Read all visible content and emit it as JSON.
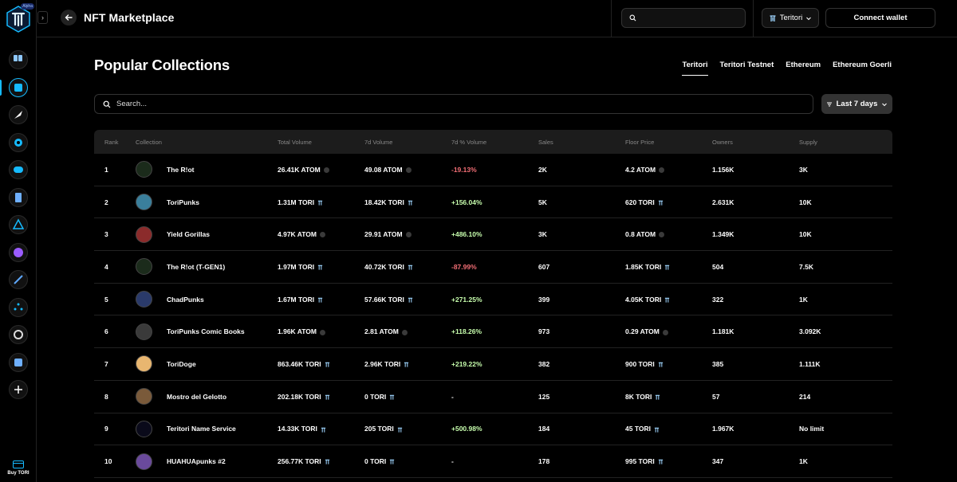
{
  "app": {
    "alpha_badge": "Alpha",
    "title": "NFT Marketplace",
    "search_placeholder": "",
    "network_label": "Teritori",
    "connect_label": "Connect wallet",
    "buy_label": "Buy TORI"
  },
  "colors": {
    "accent": "#16bbff",
    "negative": "#f46f76",
    "positive": "#c8ffae"
  },
  "sidebar": {
    "items": [
      {
        "name": "dapp-store-icon"
      },
      {
        "name": "marketplace-icon"
      },
      {
        "name": "launchpad-icon"
      },
      {
        "name": "explore-icon"
      },
      {
        "name": "social-icon"
      },
      {
        "name": "document-icon"
      },
      {
        "name": "teritori-app-icon"
      },
      {
        "name": "gradient-app-icon"
      },
      {
        "name": "rocket-app-icon"
      },
      {
        "name": "dots-app-icon"
      },
      {
        "name": "ring-app-icon"
      },
      {
        "name": "book-app-icon"
      },
      {
        "name": "add-icon"
      }
    ]
  },
  "main": {
    "section_title": "Popular Collections",
    "network_tabs": [
      "Teritori",
      "Teritori Testnet",
      "Ethereum",
      "Ethereum Goerli"
    ],
    "search_placeholder": "Search...",
    "period_filter": "Last 7 days",
    "columns": [
      "Rank",
      "Collection",
      "Total Volume",
      "7d Volume",
      "7d % Volume",
      "Sales",
      "Floor Price",
      "Owners",
      "Supply"
    ],
    "rows": [
      {
        "rank": "1",
        "name": "The R!ot",
        "total": "26.41K ATOM",
        "total_coin": "atom",
        "vol7": "49.08 ATOM",
        "vol7_coin": "atom",
        "pct": "-19.13%",
        "pct_class": "neg",
        "sales": "2K",
        "floor": "4.2 ATOM",
        "floor_coin": "atom",
        "owners": "1.156K",
        "supply": "3K",
        "avatar_color": "#1b2b1b"
      },
      {
        "rank": "2",
        "name": "ToriPunks",
        "total": "1.31M TORI",
        "total_coin": "tori",
        "vol7": "18.42K TORI",
        "vol7_coin": "tori",
        "pct": "+156.04%",
        "pct_class": "pos",
        "sales": "5K",
        "floor": "620 TORI",
        "floor_coin": "tori",
        "owners": "2.631K",
        "supply": "10K",
        "avatar_color": "#3a7f9c"
      },
      {
        "rank": "3",
        "name": "Yield Gorillas",
        "total": "4.97K ATOM",
        "total_coin": "atom",
        "vol7": "29.91 ATOM",
        "vol7_coin": "atom",
        "pct": "+486.10%",
        "pct_class": "pos",
        "sales": "3K",
        "floor": "0.8 ATOM",
        "floor_coin": "atom",
        "owners": "1.349K",
        "supply": "10K",
        "avatar_color": "#8b2b2b"
      },
      {
        "rank": "4",
        "name": "The R!ot (T-GEN1)",
        "total": "1.97M TORI",
        "total_coin": "tori",
        "vol7": "40.72K TORI",
        "vol7_coin": "tori",
        "pct": "-87.99%",
        "pct_class": "neg",
        "sales": "607",
        "floor": "1.85K TORI",
        "floor_coin": "tori",
        "owners": "504",
        "supply": "7.5K",
        "avatar_color": "#1b2b1b"
      },
      {
        "rank": "5",
        "name": "ChadPunks",
        "total": "1.67M TORI",
        "total_coin": "tori",
        "vol7": "57.66K TORI",
        "vol7_coin": "tori",
        "pct": "+271.25%",
        "pct_class": "pos",
        "sales": "399",
        "floor": "4.05K TORI",
        "floor_coin": "tori",
        "owners": "322",
        "supply": "1K",
        "avatar_color": "#2a3a6a"
      },
      {
        "rank": "6",
        "name": "ToriPunks Comic Books",
        "total": "1.96K ATOM",
        "total_coin": "atom",
        "vol7": "2.81 ATOM",
        "vol7_coin": "atom",
        "pct": "+118.26%",
        "pct_class": "pos",
        "sales": "973",
        "floor": "0.29 ATOM",
        "floor_coin": "atom",
        "owners": "1.181K",
        "supply": "3.092K",
        "avatar_color": "#3a3a3a"
      },
      {
        "rank": "7",
        "name": "ToriDoge",
        "total": "863.46K TORI",
        "total_coin": "tori",
        "vol7": "2.96K TORI",
        "vol7_coin": "tori",
        "pct": "+219.22%",
        "pct_class": "pos",
        "sales": "382",
        "floor": "900 TORI",
        "floor_coin": "tori",
        "owners": "385",
        "supply": "1.111K",
        "avatar_color": "#e8b670"
      },
      {
        "rank": "8",
        "name": "Mostro del Gelotto",
        "total": "202.18K TORI",
        "total_coin": "tori",
        "vol7": "0 TORI",
        "vol7_coin": "tori",
        "pct": "-",
        "pct_class": "neutral",
        "sales": "125",
        "floor": "8K TORI",
        "floor_coin": "tori",
        "owners": "57",
        "supply": "214",
        "avatar_color": "#7a5a3a"
      },
      {
        "rank": "9",
        "name": "Teritori Name Service",
        "total": "14.33K TORI",
        "total_coin": "tori",
        "vol7": "205 TORI",
        "vol7_coin": "tori",
        "pct": "+500.98%",
        "pct_class": "pos",
        "sales": "184",
        "floor": "45 TORI",
        "floor_coin": "tori",
        "owners": "1.967K",
        "supply": "No limit",
        "avatar_color": "#0a0a1a"
      },
      {
        "rank": "10",
        "name": "HUAHUApunks #2",
        "total": "256.77K TORI",
        "total_coin": "tori",
        "vol7": "0 TORI",
        "vol7_coin": "tori",
        "pct": "-",
        "pct_class": "neutral",
        "sales": "178",
        "floor": "995 TORI",
        "floor_coin": "tori",
        "owners": "347",
        "supply": "1K",
        "avatar_color": "#6a4a9c"
      }
    ]
  }
}
